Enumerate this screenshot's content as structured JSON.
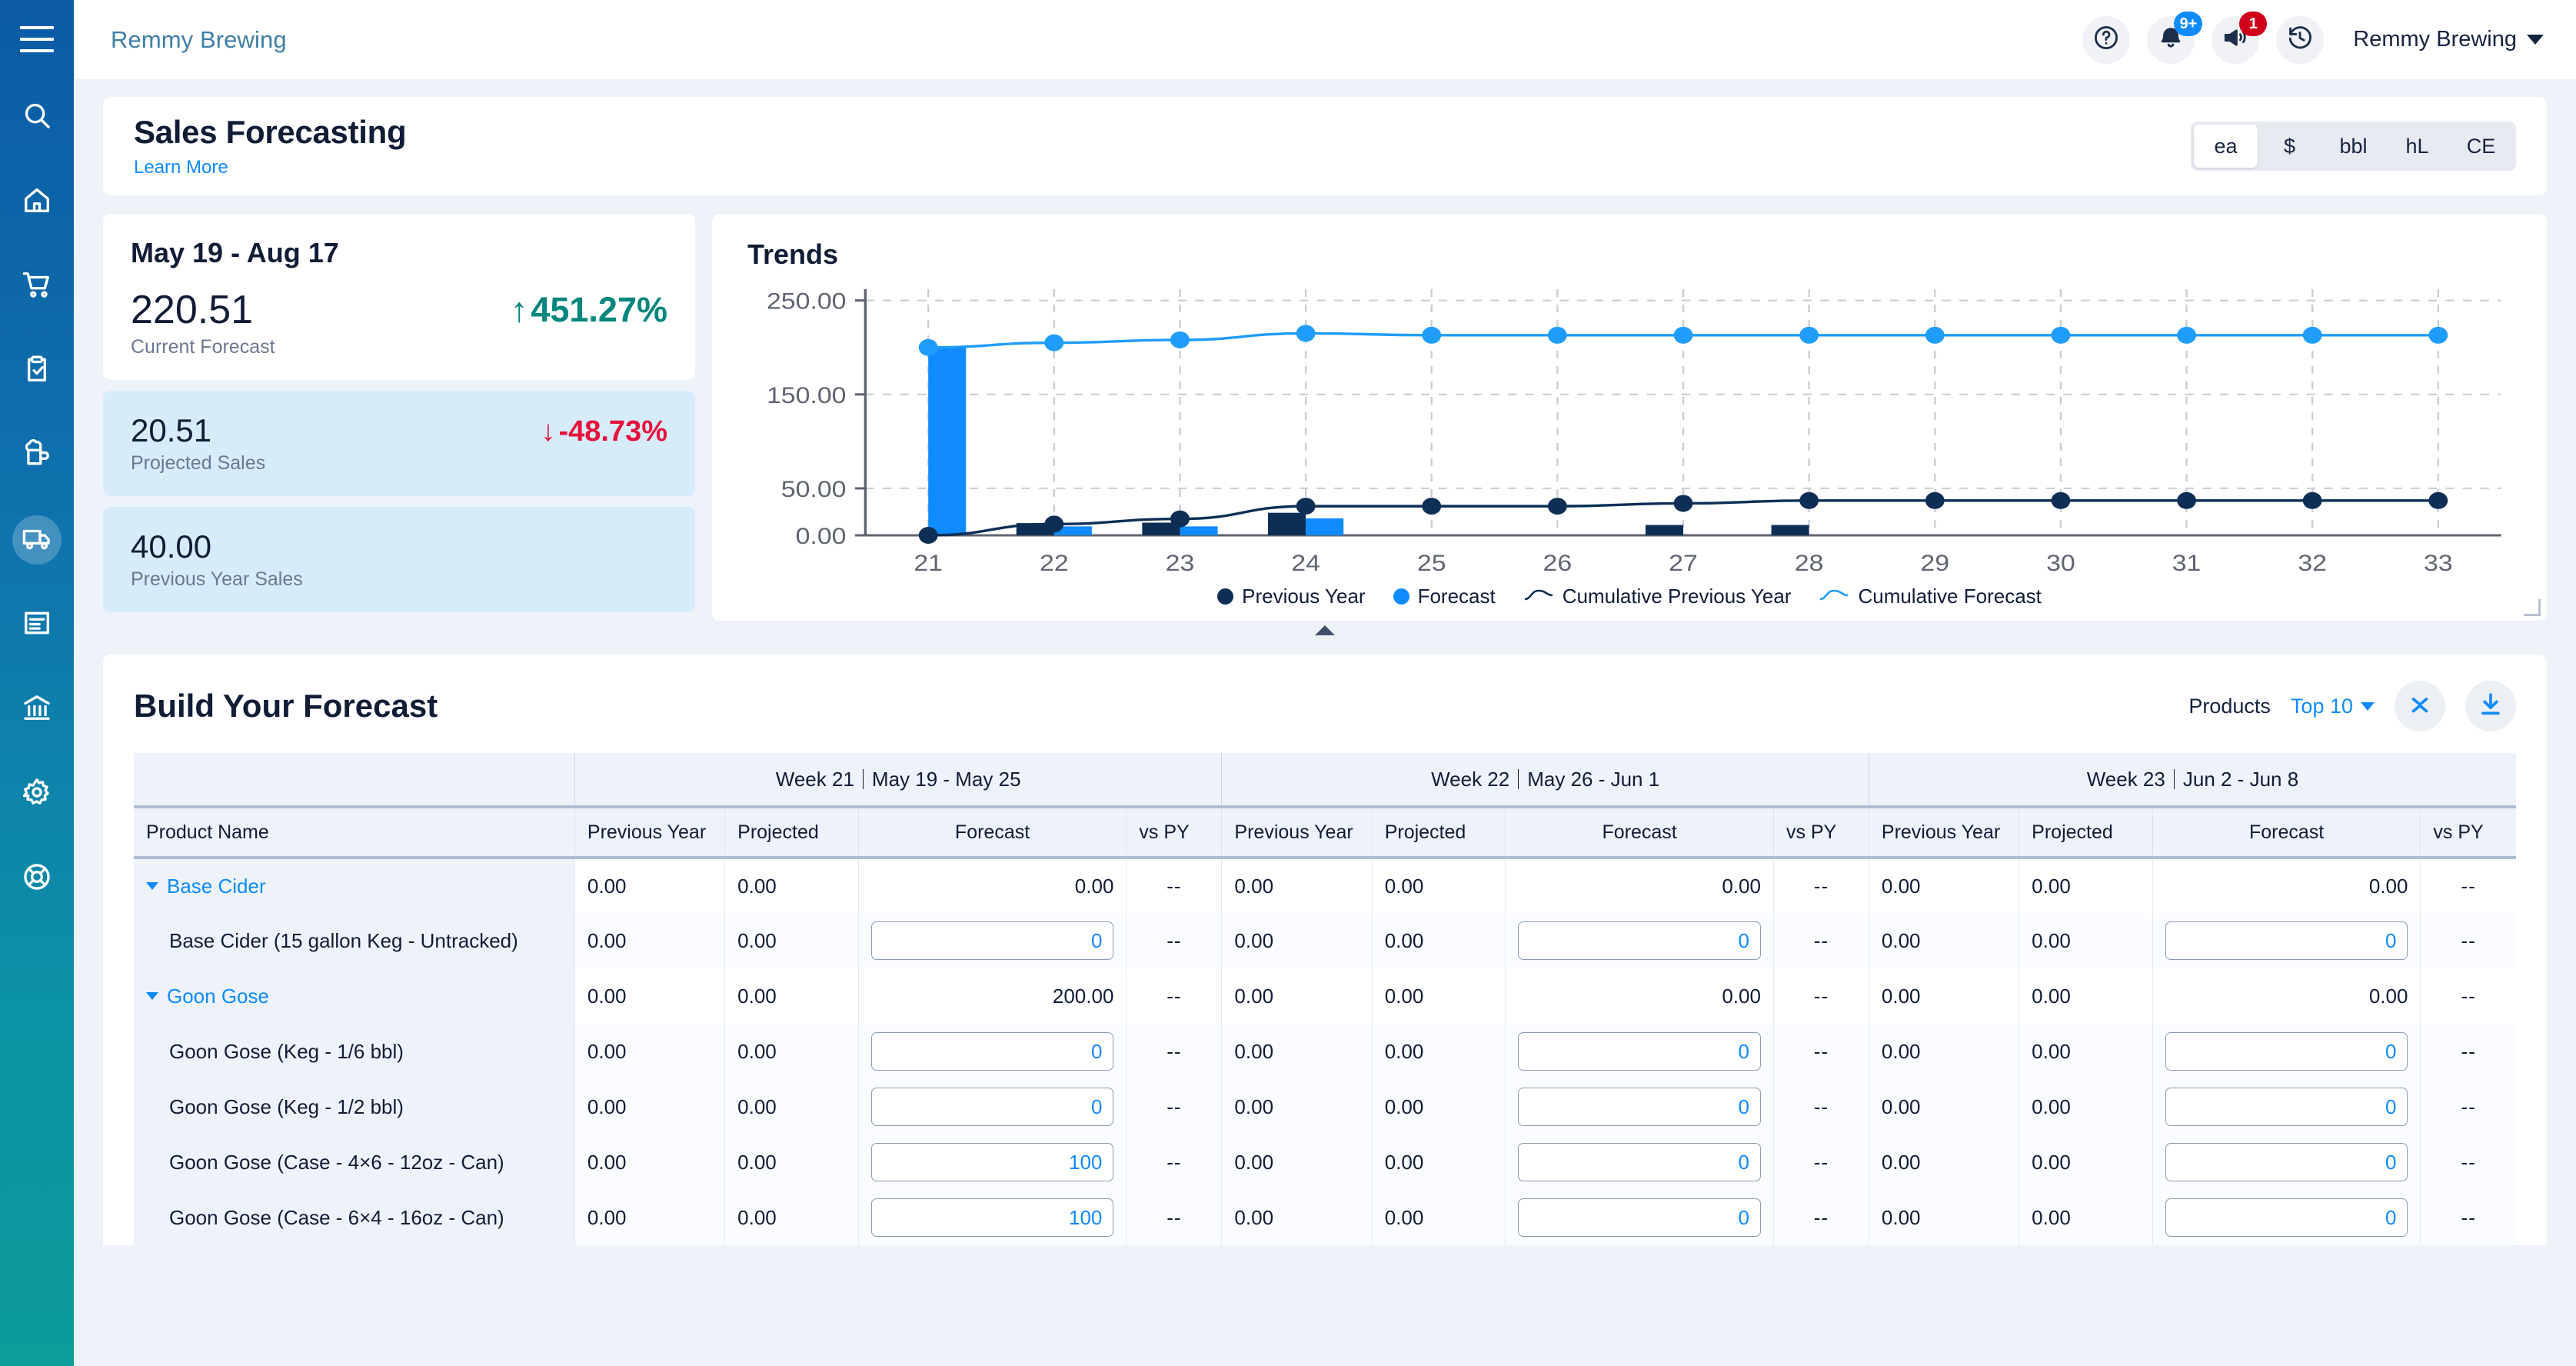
{
  "sidebar": {
    "menu_icon": "hamburger-icon",
    "items": [
      {
        "icon": "search-icon",
        "active": false
      },
      {
        "icon": "home-icon",
        "active": false
      },
      {
        "icon": "shopping-cart-icon",
        "active": false
      },
      {
        "icon": "clipboard-check-icon",
        "active": false
      },
      {
        "icon": "beer-mug-icon",
        "active": false
      },
      {
        "icon": "delivery-truck-icon",
        "active": true
      },
      {
        "icon": "document-lines-icon",
        "active": false
      },
      {
        "icon": "bank-icon",
        "active": false
      },
      {
        "icon": "gear-icon",
        "active": false
      },
      {
        "icon": "lifesaver-icon",
        "active": false
      }
    ]
  },
  "topbar": {
    "brand": "Remmy Brewing",
    "help_icon": "question-circle-icon",
    "notifications_icon": "bell-icon",
    "notifications_badge": "9+",
    "announcements_icon": "megaphone-icon",
    "announcements_badge": "1",
    "history_icon": "clock-history-icon",
    "account_name": "Remmy Brewing"
  },
  "page": {
    "title": "Sales Forecasting",
    "learn_more": "Learn More",
    "units": [
      "ea",
      "$",
      "bbl",
      "hL",
      "CE"
    ],
    "unit_selected": "ea"
  },
  "summary": {
    "date_range": "May 19 - Aug 17",
    "cards": [
      {
        "value": "220.51",
        "label": "Current Forecast",
        "delta": "451.27%",
        "arrow": "↑",
        "direction": "up"
      },
      {
        "value": "20.51",
        "label": "Projected Sales",
        "delta": "-48.73%",
        "arrow": "↓",
        "direction": "down"
      },
      {
        "value": "40.00",
        "label": "Previous Year Sales",
        "delta": "",
        "arrow": "",
        "direction": "none"
      }
    ]
  },
  "chart_data": {
    "type": "bar",
    "title": "Trends",
    "xlabel": "",
    "ylabel": "",
    "categories": [
      "21",
      "22",
      "23",
      "24",
      "25",
      "26",
      "27",
      "28",
      "29",
      "30",
      "31",
      "32",
      "33"
    ],
    "ytick_labels": [
      "0.00",
      "50.00",
      "150.00",
      "250.00"
    ],
    "ytick_values": [
      0,
      50,
      150,
      250
    ],
    "ylim": [
      0,
      262
    ],
    "grid": true,
    "legend_position": "bottom",
    "series": [
      {
        "name": "Previous Year",
        "type": "bar",
        "color": "#0d2f56",
        "values": [
          0,
          13,
          13.5,
          24,
          0,
          0,
          11,
          11,
          0,
          0,
          0,
          0,
          0
        ]
      },
      {
        "name": "Forecast",
        "type": "bar",
        "color": "#0f8bfd",
        "values": [
          200,
          9.5,
          9.5,
          18,
          0,
          0,
          0,
          0,
          0,
          0,
          0,
          0,
          0
        ]
      },
      {
        "name": "Cumulative Previous Year",
        "type": "line",
        "color": "#0d2f56",
        "values": [
          0,
          12,
          17.5,
          31,
          31,
          31,
          34,
          37,
          37,
          37,
          37,
          37,
          37
        ]
      },
      {
        "name": "Cumulative Forecast",
        "type": "line",
        "color": "#1f9dfd",
        "values": [
          200,
          205,
          208,
          215,
          213,
          213,
          213,
          213,
          213,
          213,
          213,
          213,
          213
        ]
      }
    ]
  },
  "builder": {
    "title": "Build Your Forecast",
    "products_label": "Products",
    "top_filter": "Top 10",
    "collapse_icon": "collapse-rows-icon",
    "download_icon": "download-icon",
    "week_groups": [
      {
        "week": "Week 21",
        "range": "May 19 - May 25"
      },
      {
        "week": "Week 22",
        "range": "May 26 - Jun 1"
      },
      {
        "week": "Week 23",
        "range": "Jun 2 - Jun 8"
      }
    ],
    "name_column": "Product Name",
    "sub_columns": [
      "Previous Year",
      "Projected",
      "Forecast",
      "vs PY"
    ],
    "rows": [
      {
        "type": "parent",
        "name": "Base Cider",
        "weeks": [
          {
            "py": "0.00",
            "proj": "0.00",
            "fc": "0.00",
            "vspy": "--"
          },
          {
            "py": "0.00",
            "proj": "0.00",
            "fc": "0.00",
            "vspy": "--"
          },
          {
            "py": "0.00",
            "proj": "0.00",
            "fc": "0.00",
            "vspy": "--"
          }
        ]
      },
      {
        "type": "child",
        "name": "Base Cider (15 gallon Keg - Untracked)",
        "weeks": [
          {
            "py": "0.00",
            "proj": "0.00",
            "fc": "0",
            "vspy": "--"
          },
          {
            "py": "0.00",
            "proj": "0.00",
            "fc": "0",
            "vspy": "--"
          },
          {
            "py": "0.00",
            "proj": "0.00",
            "fc": "0",
            "vspy": "--"
          }
        ]
      },
      {
        "type": "parent",
        "name": "Goon Gose",
        "weeks": [
          {
            "py": "0.00",
            "proj": "0.00",
            "fc": "200.00",
            "vspy": "--"
          },
          {
            "py": "0.00",
            "proj": "0.00",
            "fc": "0.00",
            "vspy": "--"
          },
          {
            "py": "0.00",
            "proj": "0.00",
            "fc": "0.00",
            "vspy": "--"
          }
        ]
      },
      {
        "type": "child",
        "name": "Goon Gose (Keg - 1/6 bbl)",
        "weeks": [
          {
            "py": "0.00",
            "proj": "0.00",
            "fc": "0",
            "vspy": "--"
          },
          {
            "py": "0.00",
            "proj": "0.00",
            "fc": "0",
            "vspy": "--"
          },
          {
            "py": "0.00",
            "proj": "0.00",
            "fc": "0",
            "vspy": "--"
          }
        ]
      },
      {
        "type": "child",
        "name": "Goon Gose (Keg - 1/2 bbl)",
        "weeks": [
          {
            "py": "0.00",
            "proj": "0.00",
            "fc": "0",
            "vspy": "--"
          },
          {
            "py": "0.00",
            "proj": "0.00",
            "fc": "0",
            "vspy": "--"
          },
          {
            "py": "0.00",
            "proj": "0.00",
            "fc": "0",
            "vspy": "--"
          }
        ]
      },
      {
        "type": "child",
        "name": "Goon Gose (Case - 4×6 - 12oz - Can)",
        "weeks": [
          {
            "py": "0.00",
            "proj": "0.00",
            "fc": "100",
            "vspy": "--"
          },
          {
            "py": "0.00",
            "proj": "0.00",
            "fc": "0",
            "vspy": "--"
          },
          {
            "py": "0.00",
            "proj": "0.00",
            "fc": "0",
            "vspy": "--"
          }
        ]
      },
      {
        "type": "child",
        "name": "Goon Gose (Case - 6×4 - 16oz - Can)",
        "weeks": [
          {
            "py": "0.00",
            "proj": "0.00",
            "fc": "100",
            "vspy": "--"
          },
          {
            "py": "0.00",
            "proj": "0.00",
            "fc": "0",
            "vspy": "--"
          },
          {
            "py": "0.00",
            "proj": "0.00",
            "fc": "0",
            "vspy": "--"
          }
        ]
      }
    ]
  },
  "colors": {
    "accent_blue": "#0f8bfd",
    "dark_navy": "#0d2f56",
    "up_green": "#00867d",
    "down_red": "#e8113c",
    "sidebar_top": "#0b5ba5",
    "sidebar_bottom": "#0c9c9a"
  }
}
